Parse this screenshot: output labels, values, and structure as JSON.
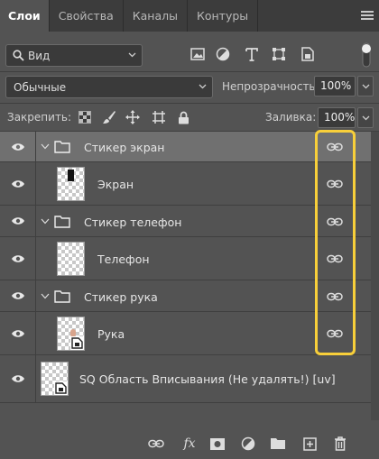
{
  "tabs": [
    {
      "label": "Слои",
      "active": true
    },
    {
      "label": "Свойства",
      "active": false
    },
    {
      "label": "Каналы",
      "active": false
    },
    {
      "label": "Контуры",
      "active": false
    }
  ],
  "filter": {
    "selected": "Вид"
  },
  "blend_mode": "Обычные",
  "opacity": {
    "label": "Непрозрачность:",
    "value": "100%"
  },
  "lock": {
    "label": "Закрепить:"
  },
  "fill": {
    "label": "Заливка:",
    "value": "100%"
  },
  "layers": [
    {
      "name": "Стикер экран",
      "type": "group",
      "expanded": true,
      "selected": true,
      "visible": true,
      "linked": true
    },
    {
      "name": "Экран",
      "type": "layer",
      "visible": true,
      "linked": true
    },
    {
      "name": "Стикер телефон",
      "type": "group",
      "expanded": true,
      "visible": true,
      "linked": true
    },
    {
      "name": "Телефон",
      "type": "layer",
      "visible": true,
      "linked": true
    },
    {
      "name": "Стикер рука",
      "type": "group",
      "expanded": true,
      "visible": true,
      "linked": true
    },
    {
      "name": "Рука",
      "type": "smart-object",
      "visible": true,
      "linked": true
    },
    {
      "name": "SQ Область Вписывания (Не удалять!) [uv]",
      "type": "smart-object",
      "visible": true,
      "linked": false
    }
  ],
  "bottom_tools": [
    "link-icon",
    "fx-icon",
    "mask-icon",
    "adjustment-icon",
    "group-folder-icon",
    "new-layer-icon",
    "trash-icon"
  ],
  "bottom_fx_label": "fx",
  "highlight_color": "#f8cf3a"
}
